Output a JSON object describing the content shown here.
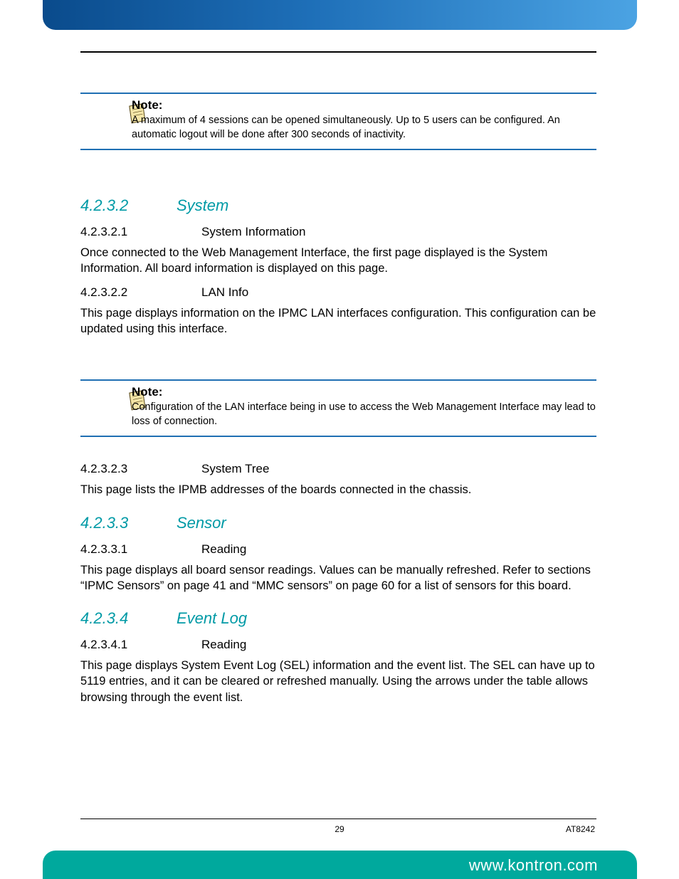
{
  "notes": [
    {
      "label": "Note:",
      "body": "A maximum of 4 sessions can be opened simultaneously. Up to 5 users can be configured. An automatic logout will be done after 300 seconds of inactivity."
    },
    {
      "label": "Note:",
      "body": "Configuration of the LAN interface being in use to access the Web Management Interface may lead to loss of connection."
    }
  ],
  "sections": {
    "s4232": {
      "num": "4.2.3.2",
      "title": "System"
    },
    "s42321": {
      "num": "4.2.3.2.1",
      "title": "System Information"
    },
    "p42321": "Once connected to the Web Management Interface, the first page displayed is the System Information. All board information is displayed on this page.",
    "s42322": {
      "num": "4.2.3.2.2",
      "title": "LAN Info"
    },
    "p42322": "This page displays information on the IPMC LAN interfaces configuration. This configuration can be updated using this interface.",
    "s42323": {
      "num": "4.2.3.2.3",
      "title": "System Tree"
    },
    "p42323": "This page lists the IPMB addresses of the boards connected in the chassis.",
    "s4233": {
      "num": "4.2.3.3",
      "title": "Sensor"
    },
    "s42331": {
      "num": "4.2.3.3.1",
      "title": "Reading"
    },
    "p42331": "This page displays all board sensor readings. Values can be manually refreshed. Refer to sections “IPMC Sensors” on page 41 and “MMC sensors” on page 60 for a list of sensors for this board.",
    "s4234": {
      "num": "4.2.3.4",
      "title": "Event Log"
    },
    "s42341": {
      "num": "4.2.3.4.1",
      "title": "Reading"
    },
    "p42341": "This page displays System Event Log (SEL) information and the event list. The SEL can have up to 5119 entries, and it can be cleared or refreshed manually. Using the arrows under the table allows browsing through the event list."
  },
  "footer": {
    "page": "29",
    "docid": "AT8242",
    "url": "www.kontron.com"
  }
}
